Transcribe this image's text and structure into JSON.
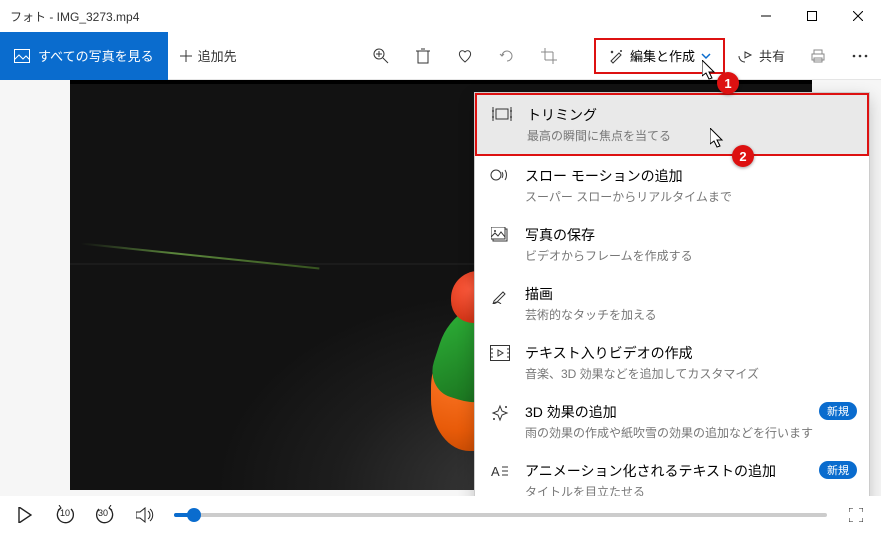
{
  "title": "フォト - IMG_3273.mp4",
  "toolbar": {
    "see_all": "すべての写真を見る",
    "add_to": "追加先",
    "edit_create": "編集と作成",
    "share": "共有"
  },
  "menu": {
    "items": [
      {
        "title": "トリミング",
        "desc": "最高の瞬間に焦点を当てる"
      },
      {
        "title": "スロー モーションの追加",
        "desc": "スーパー スローからリアルタイムまで"
      },
      {
        "title": "写真の保存",
        "desc": "ビデオからフレームを作成する"
      },
      {
        "title": "描画",
        "desc": "芸術的なタッチを加える"
      },
      {
        "title": "テキスト入りビデオの作成",
        "desc": "音楽、3D 効果などを追加してカスタマイズ"
      },
      {
        "title": "3D 効果の追加",
        "desc": "雨の効果の作成や紙吹雪の効果の追加などを行います",
        "badge": "新規"
      },
      {
        "title": "アニメーション化されるテキストの追加",
        "desc": "タイトルを目立たせる",
        "badge": "新規"
      }
    ]
  },
  "player": {
    "skip_back": "10",
    "skip_fwd": "30",
    "progress_pct": 3
  },
  "callouts": {
    "c1": "1",
    "c2": "2"
  }
}
